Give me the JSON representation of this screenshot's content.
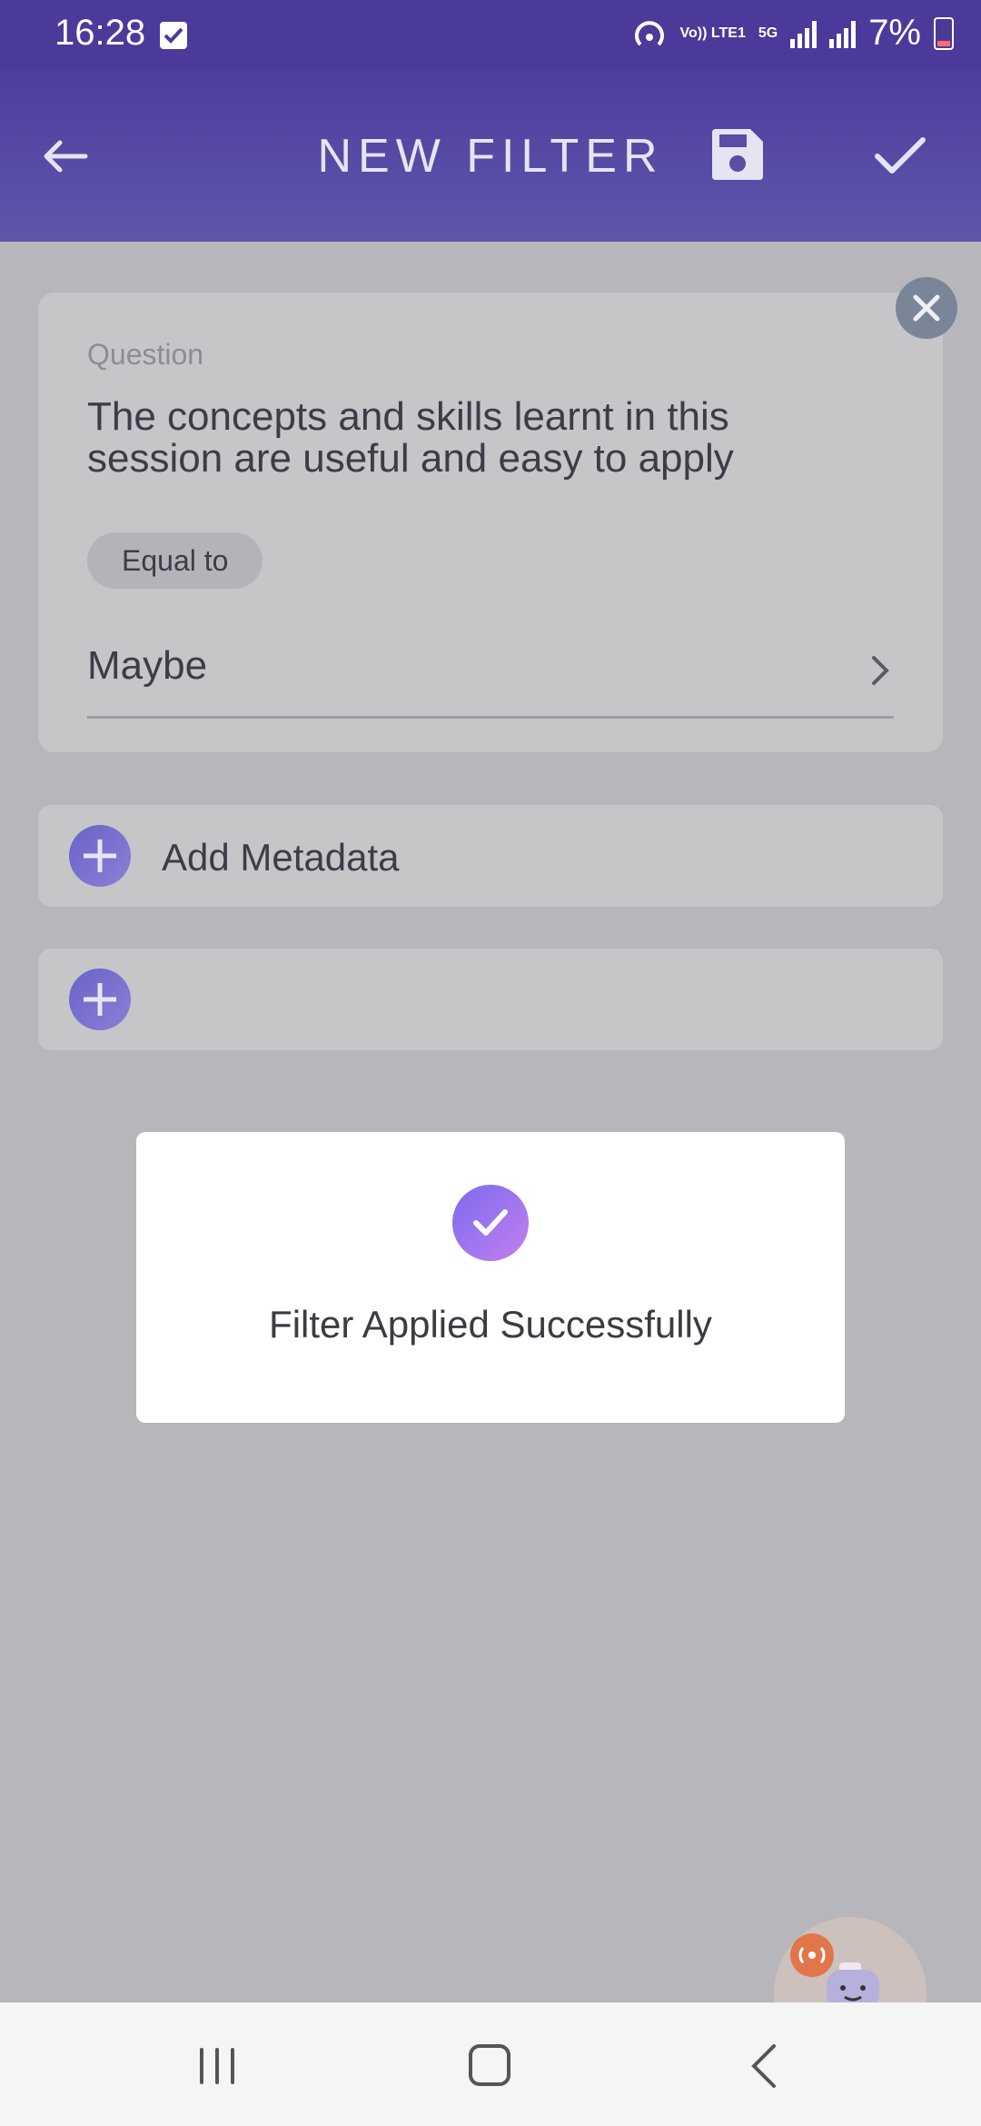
{
  "status_bar": {
    "time": "16:28",
    "battery_percent": "7%",
    "network_labels": [
      "Vo)) LTE1",
      "5G"
    ],
    "icons": [
      "checkbox-notification-icon",
      "hotspot-icon",
      "signal-icon",
      "battery-icon"
    ]
  },
  "header": {
    "title": "NEW FILTER",
    "icons": [
      "back-arrow-icon",
      "save-icon",
      "check-icon"
    ]
  },
  "filter_card": {
    "question_label": "Question",
    "question_text": "The concepts and skills learnt in this session are useful and easy to apply",
    "operator": "Equal to",
    "answer": "Maybe",
    "icons": [
      "close-icon",
      "chevron-right-icon"
    ]
  },
  "actions": {
    "add_metadata_label": "Add Metadata"
  },
  "dialog": {
    "message": "Filter Applied Successfully",
    "icon": "success-check-icon"
  },
  "assistant": {
    "icon": "assistant-bot-icon"
  },
  "colors": {
    "header": "#4d3d9e",
    "accent": "#6a63c8",
    "overlay_background": "#b7b7bb",
    "dialog_icon_gradient": [
      "#7c6bee",
      "#c37ff0"
    ]
  }
}
